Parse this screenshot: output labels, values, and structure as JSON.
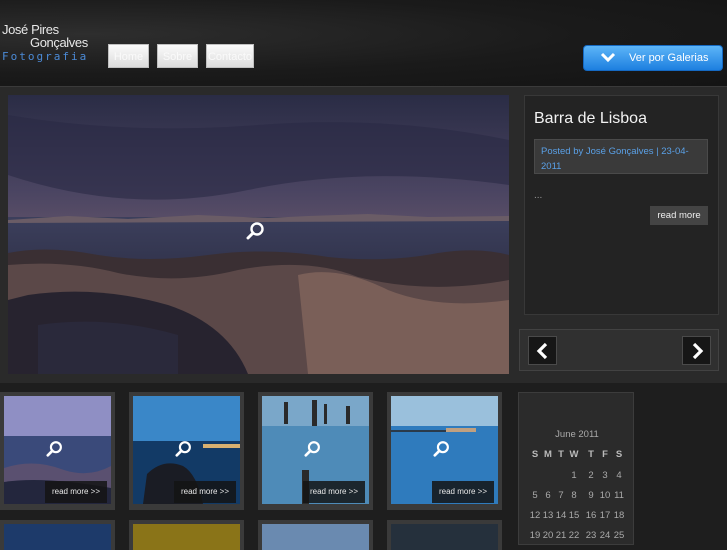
{
  "logo": {
    "line1": "José Pires",
    "line2": "Gonçalves",
    "line3": "Fotografia"
  },
  "nav": {
    "items": [
      "Home",
      "Sobre",
      "Contacto"
    ]
  },
  "galerias_button": {
    "label": "Ver por Galerias",
    "icon": "chevron-down-icon"
  },
  "featured": {
    "title": "Barra de Lisboa",
    "meta_line1": "Posted by José Gonçalves | 23-04-",
    "meta_line2": "2011",
    "excerpt": "...",
    "read_more": "read more",
    "prev_icon": "chevron-left-icon",
    "next_icon": "chevron-right-icon",
    "zoom_icon": "magnifier-icon"
  },
  "thumbnails": [
    {
      "read_more": "read more >>"
    },
    {
      "read_more": "read more >>"
    },
    {
      "read_more": "read more >>"
    },
    {
      "read_more": "read more >>"
    }
  ],
  "calendar": {
    "caption": "June 2011",
    "days_header": [
      "S",
      "M",
      "T",
      "W",
      "T",
      "F",
      "S"
    ],
    "rows": [
      [
        "",
        "",
        "",
        "1",
        "2",
        "3",
        "4"
      ],
      [
        "5",
        "6",
        "7",
        "8",
        "9",
        "10",
        "11"
      ],
      [
        "12",
        "13",
        "14",
        "15",
        "16",
        "17",
        "18"
      ],
      [
        "19",
        "20",
        "21",
        "22",
        "23",
        "24",
        "25"
      ]
    ]
  },
  "colors": {
    "accent": "#2a88e8",
    "link": "#5aa0e6",
    "background": "#1e1e1e"
  }
}
